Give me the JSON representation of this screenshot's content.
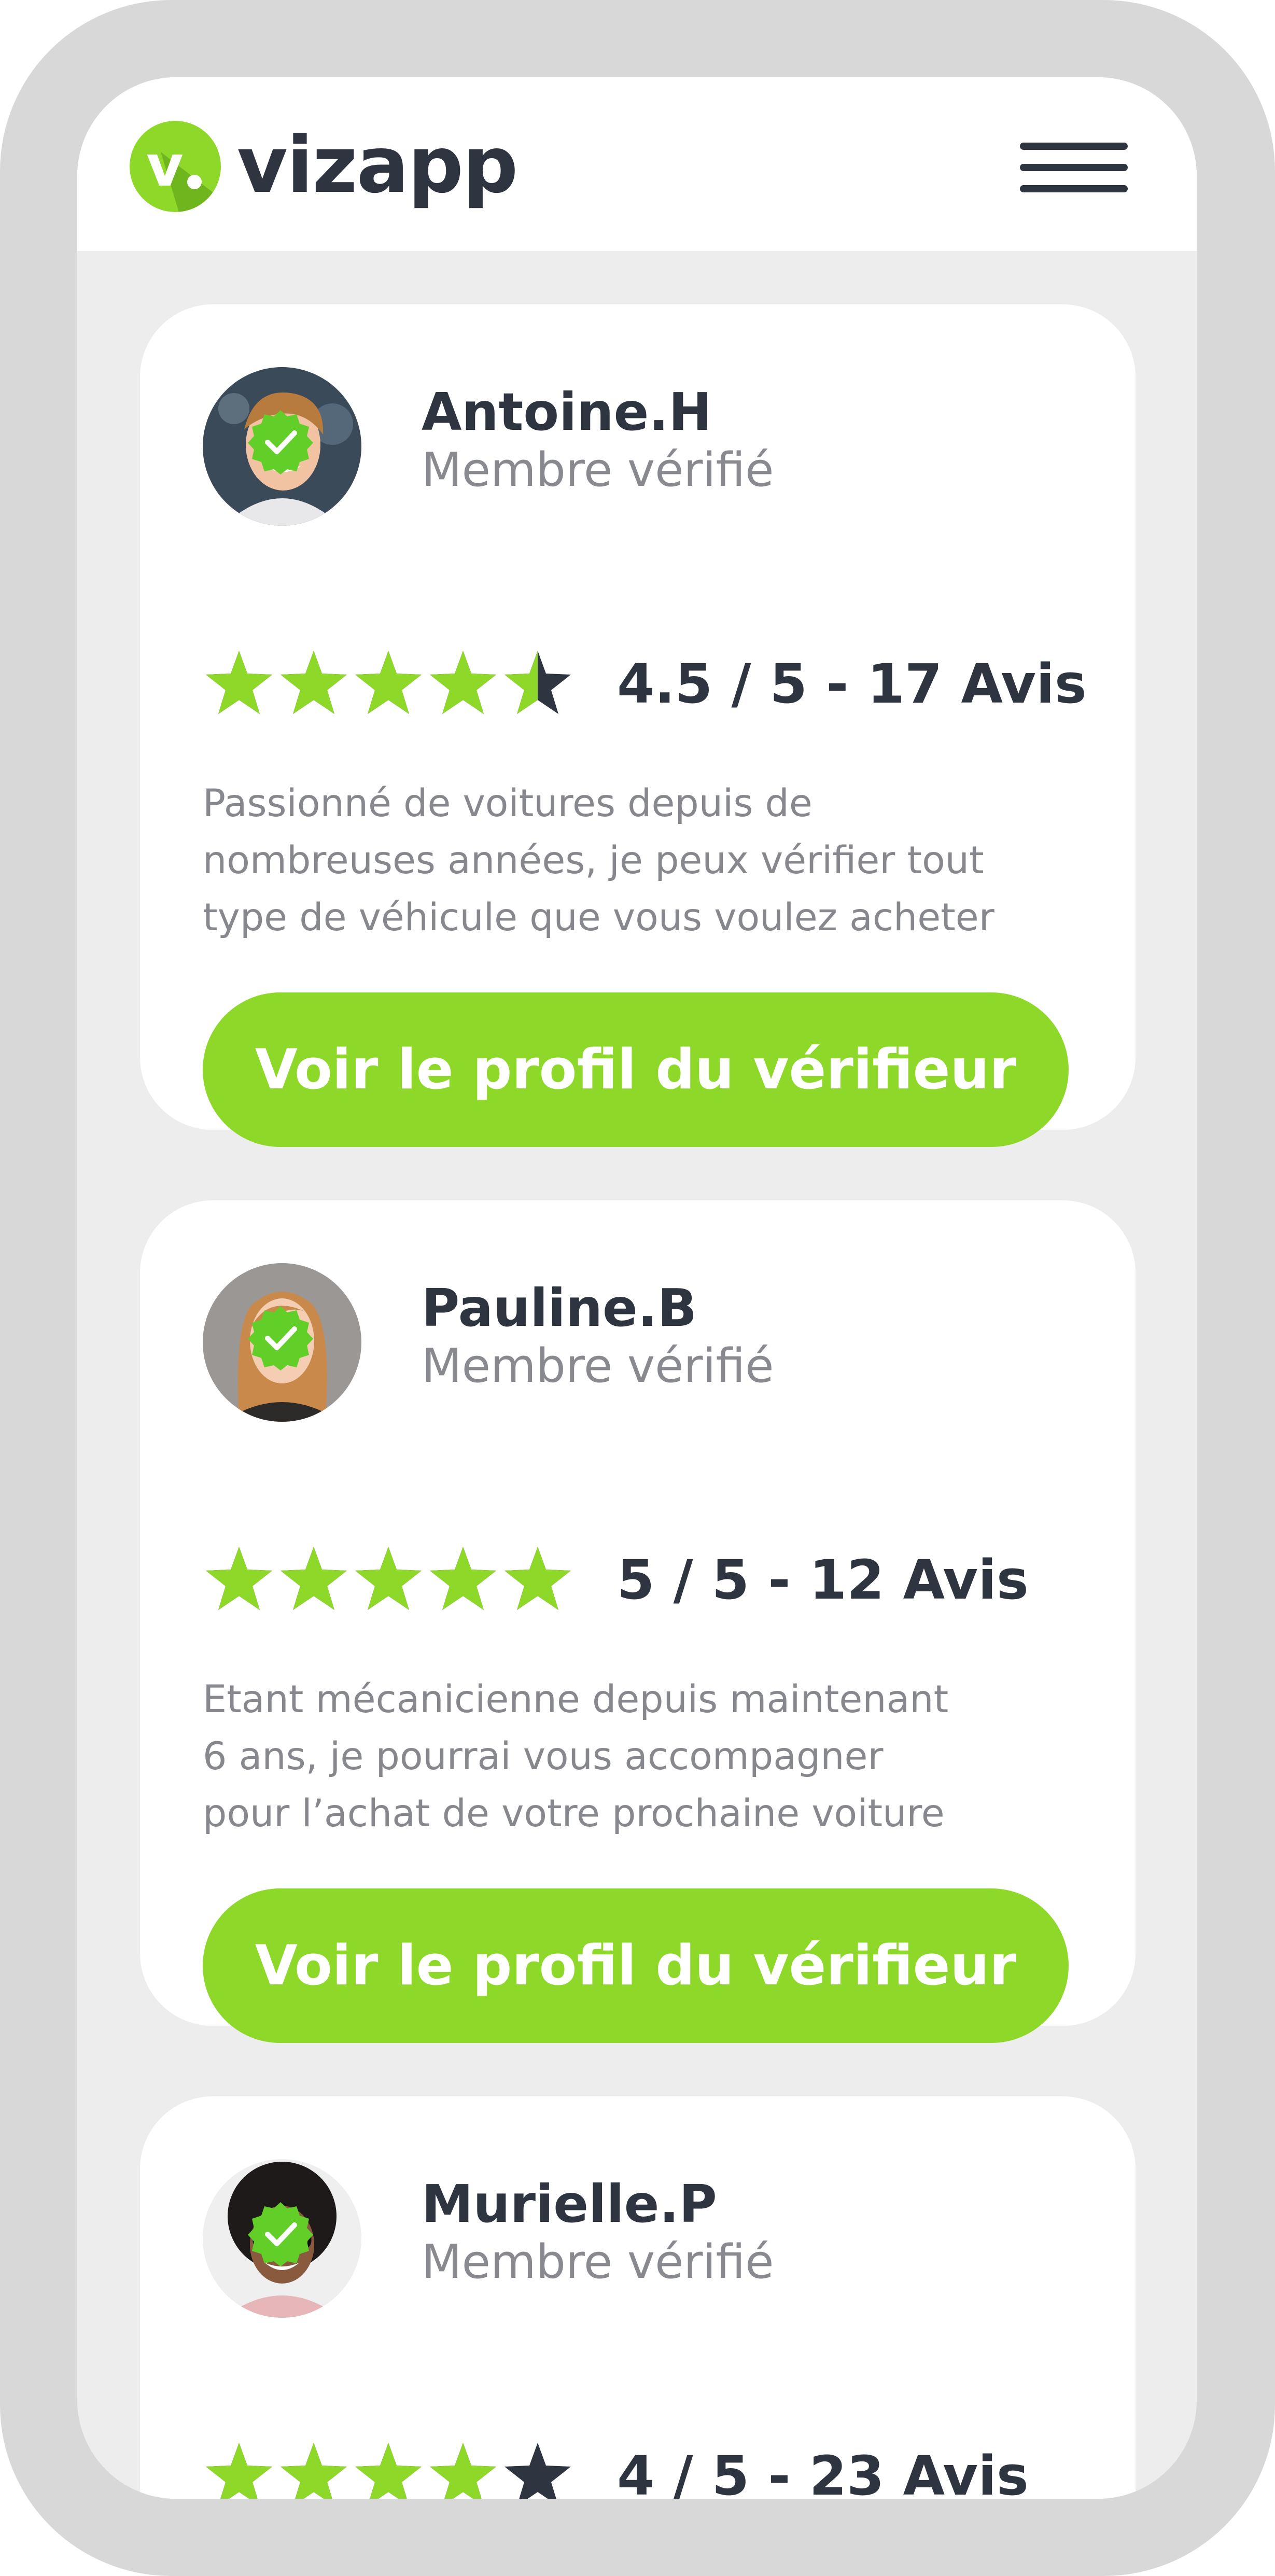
{
  "brand": {
    "name": "vizapp",
    "logo_letter": "v.",
    "accent": "#8ed82a",
    "dark": "#2f3540"
  },
  "header": {
    "menu_icon": "hamburger-icon"
  },
  "cards": [
    {
      "name": "Antoine.H",
      "status": "Membre vérifié",
      "rating_value": 4.5,
      "rating_text": "4.5 / 5 - 17 Avis",
      "description": [
        "Passionné de voitures depuis de",
        "nombreuses années, je peux vérifier tout",
        "type de véhicule que vous voulez acheter"
      ],
      "cta": "Voir le profil du vérifieur"
    },
    {
      "name": "Pauline.B",
      "status": "Membre vérifié",
      "rating_value": 5,
      "rating_text": "5 / 5 - 12 Avis",
      "description": [
        "Etant mécanicienne depuis maintenant",
        "6 ans, je pourrai vous accompagner",
        "pour l’achat de votre prochaine voiture"
      ],
      "cta": "Voir le profil du vérifieur"
    },
    {
      "name": "Murielle.P",
      "status": "Membre vérifié",
      "rating_value": 4,
      "rating_text": "4 / 5 - 23 Avis"
    }
  ]
}
